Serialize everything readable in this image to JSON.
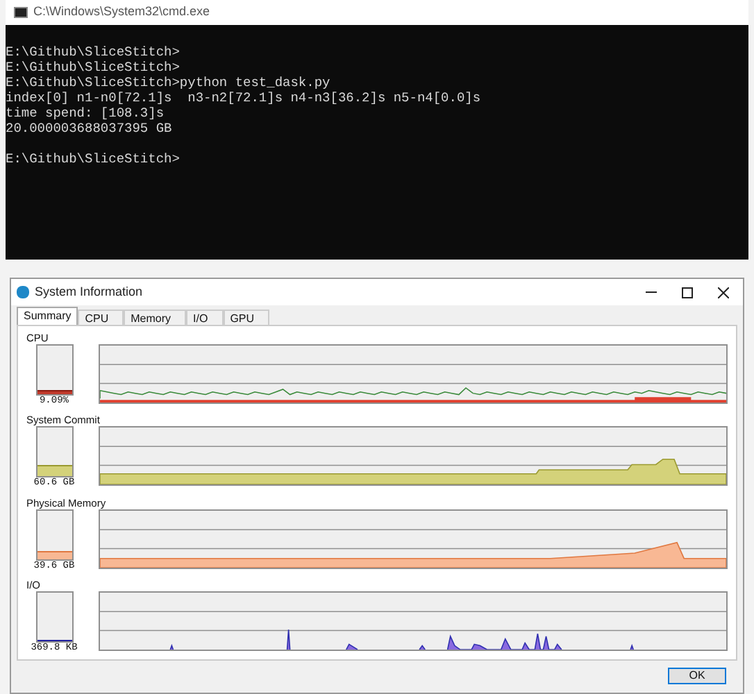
{
  "console": {
    "title": "C:\\Windows\\System32\\cmd.exe",
    "blocks": [
      [
        "E:\\Github\\SliceStitch>",
        "E:\\Github\\SliceStitch>",
        "E:\\Github\\SliceStitch>python test_dask.py",
        "index[0] n1-n0[72.1]s  n3-n2[72.1]s n4-n3[36.2]s n5-n4[0.0]s",
        "time spend: [108.3]s",
        "20.000003688037395 GB"
      ],
      [
        "E:\\Github\\SliceStitch>"
      ]
    ]
  },
  "sysinfo": {
    "title": "System Information",
    "tabs": [
      {
        "label": "Summary",
        "selected": true
      },
      {
        "label": "CPU",
        "selected": false
      },
      {
        "label": "Memory",
        "selected": false
      },
      {
        "label": "I/O",
        "selected": false
      },
      {
        "label": "GPU",
        "selected": false
      }
    ],
    "sections": [
      {
        "kind": "cpu",
        "label": "CPU",
        "reading": "9.09%",
        "level": 0.09
      },
      {
        "kind": "commit",
        "label": "System Commit",
        "reading": "60.6 GB",
        "level": 0.25
      },
      {
        "kind": "memory",
        "label": "Physical Memory",
        "reading": "39.6 GB",
        "level": 0.15
      },
      {
        "kind": "io",
        "label": "I/O",
        "reading": "369.8 KB",
        "level": 0.02
      }
    ],
    "ok_button": "OK"
  }
}
